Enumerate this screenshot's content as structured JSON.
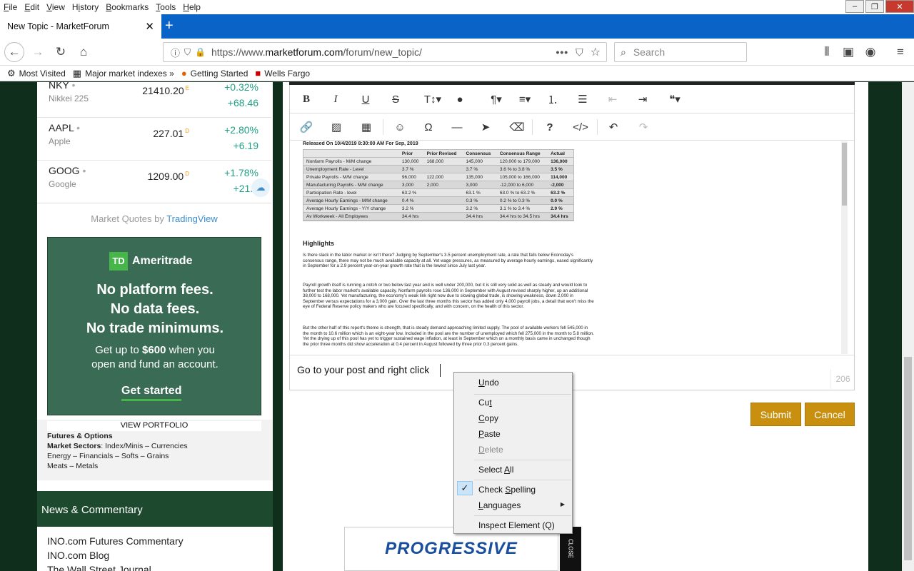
{
  "menubar": [
    "File",
    "Edit",
    "View",
    "History",
    "Bookmarks",
    "Tools",
    "Help"
  ],
  "tab": {
    "title": "New Topic - MarketForum"
  },
  "url": {
    "prefix": "https://www.",
    "host": "marketforum.com",
    "path": "/forum/new_topic/"
  },
  "search": {
    "placeholder": "Search"
  },
  "bookmarks": [
    {
      "label": "Most Visited",
      "icon": "gear-icon"
    },
    {
      "label": "Major market indexes »",
      "icon": "chart-icon"
    },
    {
      "label": "Getting Started",
      "icon": "firefox-icon"
    },
    {
      "label": "Wells Fargo",
      "icon": "wellsfargo-icon"
    }
  ],
  "quotes": [
    {
      "symbol": "NKY",
      "name": "Nikkei 225",
      "price": "21410.20",
      "flag": "E",
      "change_pct": "+0.32%",
      "change": "+68.46"
    },
    {
      "symbol": "AAPL",
      "name": "Apple",
      "price": "227.01",
      "flag": "D",
      "change_pct": "+2.80%",
      "change": "+6.19"
    },
    {
      "symbol": "GOOG",
      "name": "Google",
      "price": "1209.00",
      "flag": "D",
      "change_pct": "+1.78%",
      "change": "+21.1"
    }
  ],
  "quote_footer": {
    "prefix": "Market Quotes by ",
    "brand": "TradingView"
  },
  "ad_td": {
    "logo_mark": "TD",
    "logo": "Ameritrade",
    "l1": "No platform fees.",
    "l2": "No data fees.",
    "l3": "No trade minimums.",
    "s1a": "Get up to ",
    "s1b": "$600",
    "s1c": " when you",
    "s2": "open and fund an account.",
    "cta": "Get started"
  },
  "portfolio": {
    "view": "VIEW PORTFOLIO",
    "futures": "Futures & Options",
    "sectors_label": "Market Sectors",
    "sectors_1": ": Index/Minis – Currencies",
    "sectors_2": "Energy – Financials – Softs – Grains",
    "sectors_3": "Meats – Metals"
  },
  "news": {
    "title": "News & Commentary",
    "items": [
      "INO.com Futures Commentary",
      "INO.com Blog",
      "The Wall Street Journal"
    ]
  },
  "report": {
    "released": "Released On 10/4/2019 8:30:00 AM For Sep, 2019",
    "headers": [
      "",
      "Prior",
      "Prior Revised",
      "Consensus",
      "Consensus Range",
      "Actual"
    ],
    "rows": [
      [
        "Nonfarm Payrolls - M/M change",
        "130,000",
        "168,000",
        "145,000",
        "120,000  to 179,000",
        "136,000"
      ],
      [
        "Unemployment Rate - Level",
        "3.7 %",
        "",
        "3.7 %",
        "3.6 % to 3.8 %",
        "3.5 %"
      ],
      [
        "Private Payrolls - M/M change",
        "96,000",
        "122,000",
        "135,000",
        "105,000  to 166,000",
        "114,000"
      ],
      [
        "Manufacturing Payrolls - M/M change",
        "3,000",
        "2,000",
        "3,000",
        "-12,000  to 6,000",
        "-2,000"
      ],
      [
        "Participation Rate - level",
        "63.2 %",
        "",
        "63.1 %",
        "63.0 % to 63.2 %",
        "63.2 %"
      ],
      [
        "Average Hourly Earnings - M/M change",
        "0.4 %",
        "",
        "0.3 %",
        "0.2 % to 0.3 %",
        "0.0 %"
      ],
      [
        "Average Hourly Earnings - Y/Y change",
        "3.2 %",
        "",
        "3.2 %",
        "3.1 % to 3.4 %",
        "2.9 %"
      ],
      [
        "Av Workweek - All Employees",
        "34.4 hrs",
        "",
        "34.4 hrs",
        "34.4 hrs to 34.5 hrs",
        "34.4 hrs"
      ]
    ],
    "highlights": "Highlights",
    "p1": "Is there slack in the labor market or isn't there? Judging by September's 3.5 percent unemployment rate, a rate that falls below Econoday's consensus range, there may not be much available capacity at all. Yet wage pressures, as measured by average hourly earnings, eased significantly in September for a 2.9 percent year-on-year growth rate that is the lowest since July last year.",
    "p2": "Payroll growth itself is running a notch or two below last year and is well under 200,000, but it is still very solid as well as steady and would look to further test the labor market's available capacity. Nonfarm payrolls rose 136,000 in September with August revised sharply higher, up an additional 38,000 to 168,000. Yet manufacturing, the economy's weak link right now due to slowing global trade, is showing weakness, down 2,000 in September versus expectations for a 3,000 gain. Over the last three months this sector has added only 4,000 payroll jobs, a detail that won't miss the eye of Federal Reserve policy makers who are focused specifically, and with concern, on the health of this sector.",
    "p3": "But the other half of this report's theme is strength, that is steady demand approaching limited supply. The pool of available workers fell 545,000 in the month to 10.6 million which is an eight-year low. Included in the pool are the number of unemployed which fell 275,000 in the month to 5.8 million. Yet the drying up of this pool has yet to trigger sustained wage inflation, at least in September which on a monthly basis came in unchanged though the prior three months did show acceleration at 0.4 percent in August followed by three prior 0.3 percent gains."
  },
  "editor": {
    "typed": "Go to your post and right click",
    "char_count": "206"
  },
  "buttons": {
    "submit": "Submit",
    "cancel": "Cancel"
  },
  "context_menu": {
    "undo": "Undo",
    "cut": "Cut",
    "copy": "Copy",
    "paste": "Paste",
    "delete": "Delete",
    "select_all": "Select All",
    "check_spelling": "Check Spelling",
    "languages": "Languages",
    "inspect": "Inspect Element (Q)"
  },
  "ad_progressive": {
    "brand": "PROGRESSIVE",
    "close": "CLOSE"
  }
}
